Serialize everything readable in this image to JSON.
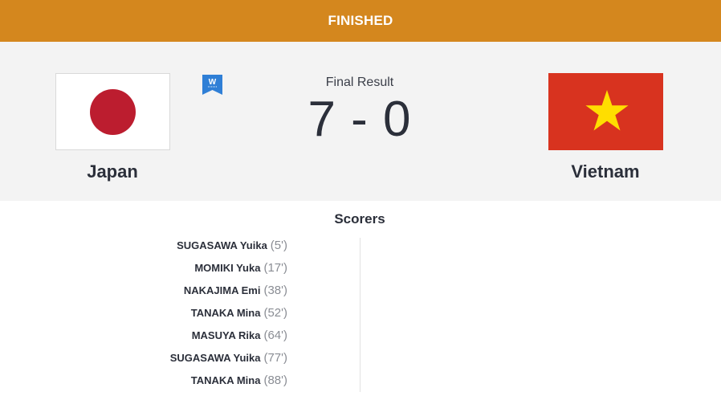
{
  "status": "FINISHED",
  "result_label": "Final Result",
  "score": "7 - 0",
  "home": {
    "name": "Japan"
  },
  "away": {
    "name": "Vietnam"
  },
  "badge_letter": "W",
  "scorers_title": "Scorers",
  "home_scorers": [
    {
      "name": "SUGASAWA Yuika",
      "minute": "(5')"
    },
    {
      "name": "MOMIKI Yuka",
      "minute": "(17')"
    },
    {
      "name": "NAKAJIMA Emi",
      "minute": "(38')"
    },
    {
      "name": "TANAKA Mina",
      "minute": "(52')"
    },
    {
      "name": "MASUYA Rika",
      "minute": "(64')"
    },
    {
      "name": "SUGASAWA Yuika",
      "minute": "(77')"
    },
    {
      "name": "TANAKA Mina",
      "minute": "(88')"
    }
  ],
  "away_scorers": [],
  "colors": {
    "status_bar": "#d4871e",
    "panel_bg": "#f3f3f3",
    "badge": "#2f7fd6",
    "japan_disc": "#bc1d2f",
    "vietnam_red": "#d8331f",
    "vietnam_star": "#ffde00"
  }
}
